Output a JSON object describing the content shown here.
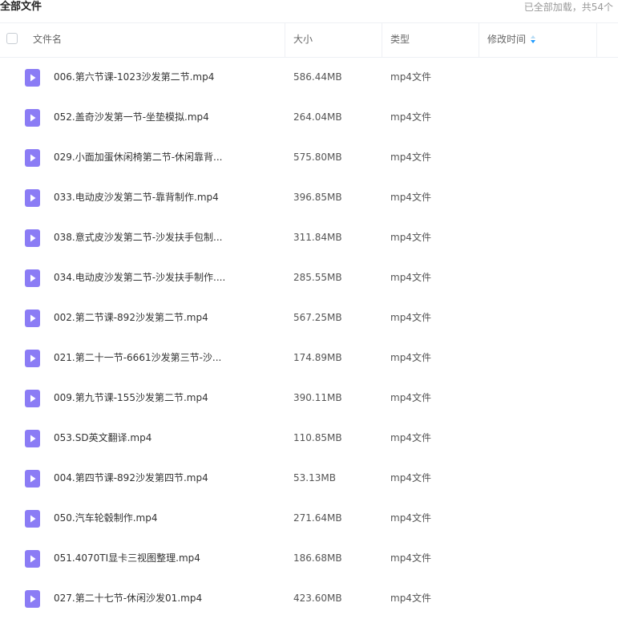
{
  "topbar": {
    "title": "全部文件",
    "status": "已全部加载，共54个"
  },
  "columns": {
    "name": "文件名",
    "size": "大小",
    "type": "类型",
    "modified": "修改时间"
  },
  "colors": {
    "icon": "#8b7cf5",
    "sort_active": "#1e9bff"
  },
  "files": [
    {
      "name": "006.第六节课-1023沙发第二节.mp4",
      "size": "586.44MB",
      "type": "mp4文件"
    },
    {
      "name": "052.盖奇沙发第一节-坐垫模拟.mp4",
      "size": "264.04MB",
      "type": "mp4文件"
    },
    {
      "name": "029.小面加蛋休闲椅第二节-休闲靠背...",
      "size": "575.80MB",
      "type": "mp4文件"
    },
    {
      "name": "033.电动皮沙发第二节-靠背制作.mp4",
      "size": "396.85MB",
      "type": "mp4文件"
    },
    {
      "name": "038.意式皮沙发第二节-沙发扶手包制...",
      "size": "311.84MB",
      "type": "mp4文件"
    },
    {
      "name": "034.电动皮沙发第二节-沙发扶手制作....",
      "size": "285.55MB",
      "type": "mp4文件"
    },
    {
      "name": "002.第二节课-892沙发第二节.mp4",
      "size": "567.25MB",
      "type": "mp4文件"
    },
    {
      "name": "021.第二十一节-6661沙发第三节-沙...",
      "size": "174.89MB",
      "type": "mp4文件"
    },
    {
      "name": "009.第九节课-155沙发第二节.mp4",
      "size": "390.11MB",
      "type": "mp4文件"
    },
    {
      "name": "053.SD英文翻译.mp4",
      "size": "110.85MB",
      "type": "mp4文件"
    },
    {
      "name": "004.第四节课-892沙发第四节.mp4",
      "size": "53.13MB",
      "type": "mp4文件"
    },
    {
      "name": "050.汽车轮毂制作.mp4",
      "size": "271.64MB",
      "type": "mp4文件"
    },
    {
      "name": "051.4070TI显卡三视图整理.mp4",
      "size": "186.68MB",
      "type": "mp4文件"
    },
    {
      "name": "027.第二十七节-休闲沙发01.mp4",
      "size": "423.60MB",
      "type": "mp4文件"
    }
  ]
}
